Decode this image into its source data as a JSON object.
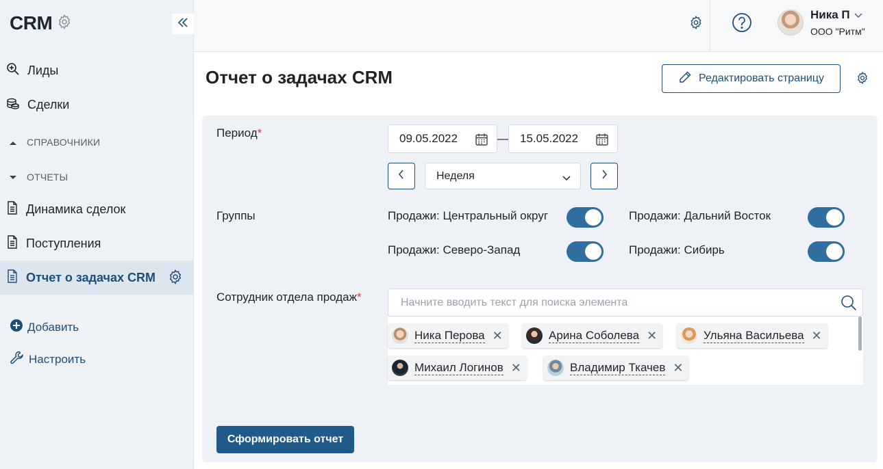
{
  "sidebar": {
    "title": "CRM",
    "items": [
      {
        "label": "Лиды",
        "icon": "search-zoom-icon"
      },
      {
        "label": "Сделки",
        "icon": "coins-icon"
      }
    ],
    "sections": [
      {
        "label": "СПРАВОЧНИКИ",
        "state": "collapsed"
      },
      {
        "label": "ОТЧЕТЫ",
        "state": "expanded"
      }
    ],
    "reports": [
      {
        "label": "Динамика сделок"
      },
      {
        "label": "Поступления"
      },
      {
        "label": "Отчет о задачах CRM",
        "active": true
      }
    ],
    "actions": {
      "add": "Добавить",
      "configure": "Настроить"
    }
  },
  "topbar": {
    "user": {
      "name": "Ника П",
      "org": "ООО \"Ритм\""
    }
  },
  "page": {
    "title": "Отчет о задачах CRM",
    "edit_button": "Редактировать страницу"
  },
  "form": {
    "period": {
      "label": "Период",
      "required_mark": "*",
      "date_from": "09.05.2022",
      "date_to": "15.05.2022",
      "separator": "—",
      "interval": "Неделя"
    },
    "groups": {
      "label": "Группы",
      "toggles": [
        {
          "label": "Продажи: Центральный округ",
          "on": true
        },
        {
          "label": "Продажи: Дальний Восток",
          "on": true
        },
        {
          "label": "Продажи: Северо-Запад",
          "on": true
        },
        {
          "label": "Продажи: Сибирь",
          "on": true
        }
      ]
    },
    "employees": {
      "label": "Сотрудник отдела продаж",
      "required_mark": "*",
      "search_placeholder": "Начните вводить текст для поиска элемента",
      "selected": [
        {
          "name": "Ника Перова"
        },
        {
          "name": "Арина Соболева"
        },
        {
          "name": "Ульяна Васильева"
        },
        {
          "name": "Михаил Логинов"
        },
        {
          "name": "Владимир Ткачев"
        }
      ]
    },
    "submit": "Сформировать отчет"
  },
  "colors": {
    "accent": "#1f4e79",
    "toggle_on": "#2f6f9f",
    "sidebar_bg": "#eef2f7",
    "required": "#d63b3b"
  }
}
